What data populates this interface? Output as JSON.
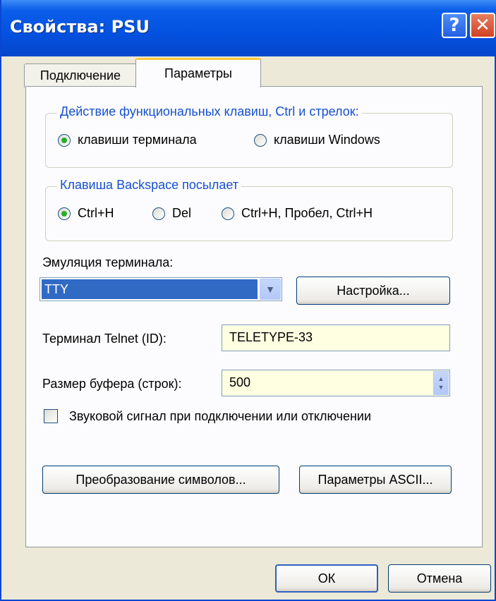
{
  "window": {
    "title": "Свойства: PSU"
  },
  "titlebar": {
    "help_symbol": "?",
    "close_symbol": "✕"
  },
  "tabs": [
    {
      "label": "Подключение"
    },
    {
      "label": "Параметры"
    }
  ],
  "function_keys": {
    "legend": "Действие функциональных клавиш, Ctrl и стрелок:",
    "options": [
      "клавиши терминала",
      "клавиши Windows"
    ],
    "selected": "клавиши терминала"
  },
  "backspace": {
    "legend": "Клавиша  Backspace посылает",
    "options": [
      "Ctrl+H",
      "Del",
      "Ctrl+H, Пробел, Ctrl+H"
    ],
    "selected": "Ctrl+H"
  },
  "emulation": {
    "label": "Эмуляция терминала:",
    "value": "TTY",
    "setup_button": "Настройка..."
  },
  "telnet": {
    "label": "Терминал Telnet (ID):",
    "value": "TELETYPE-33"
  },
  "buffer": {
    "label": "Размер буфера (строк):",
    "value": "500"
  },
  "sound": {
    "label": "Звуковой сигнал при подключении или отключении",
    "checked": false
  },
  "buttons": {
    "translation": "Преобразование символов...",
    "ascii": "Параметры ASCII...",
    "ok": "ОК",
    "cancel": "Отмена"
  },
  "colors": {
    "titlebar": "#0351e0",
    "accent_orange": "#ffc83c",
    "legend_blue": "#1650cf",
    "selection": "#316ac5",
    "input_bg": "#ffffe1"
  }
}
